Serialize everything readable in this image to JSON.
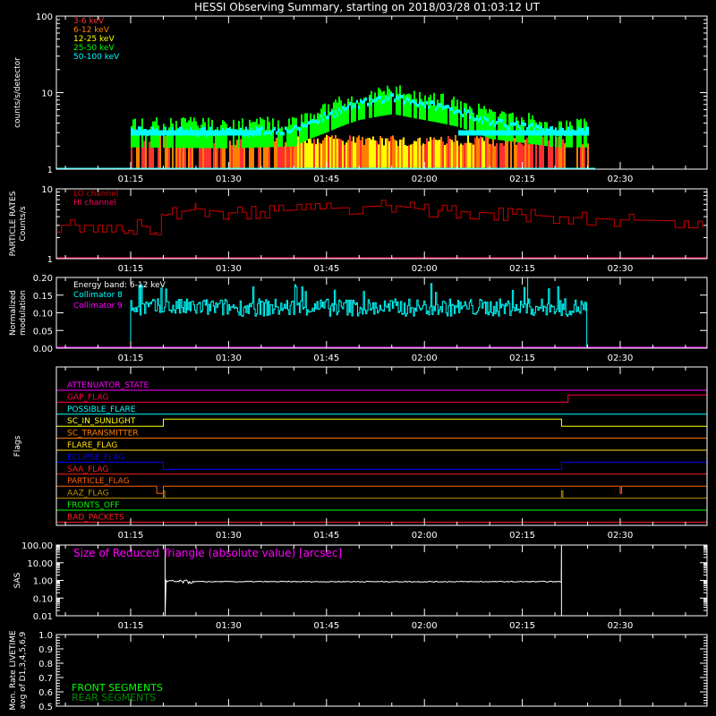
{
  "title": "HESSI Observing Summary, starting on 2018/03/28 01:03:12 UT",
  "time_ticks": [
    "01:15",
    "01:30",
    "01:45",
    "02:00",
    "02:15",
    "02:30"
  ],
  "colors": {
    "background": "#000000",
    "axes": "#ffffff"
  },
  "chart_data": [
    {
      "type": "bar",
      "panel": "count-rates",
      "ylabel": "counts/s/detector",
      "yscale": "log",
      "ylim": [
        1,
        100
      ],
      "y_ticks": [
        "1",
        "10",
        "100"
      ],
      "legend_placement": "top-left",
      "bands": [
        {
          "name": "3-6 keV",
          "color": "#ff3030"
        },
        {
          "name": "6-12 keV",
          "color": "#ff8000"
        },
        {
          "name": "12-25 keV",
          "color": "#ffff00"
        },
        {
          "name": "25-50 keV",
          "color": "#00ff00"
        },
        {
          "name": "50-100 keV",
          "color": "#00ffff"
        }
      ],
      "time_range": [
        "01:15",
        "02:25"
      ],
      "profile": [
        {
          "time": "01:15",
          "counts": 3.5
        },
        {
          "time": "01:30",
          "counts": 3.4
        },
        {
          "time": "01:40",
          "counts": 3.6
        },
        {
          "time": "01:45",
          "counts": 5.5
        },
        {
          "time": "01:50",
          "counts": 8.0
        },
        {
          "time": "01:55",
          "counts": 9.5
        },
        {
          "time": "01:58",
          "counts": 8.5
        },
        {
          "time": "02:05",
          "counts": 6.5
        },
        {
          "time": "02:10",
          "counts": 4.5
        },
        {
          "time": "02:20",
          "counts": 3.5
        },
        {
          "time": "02:25",
          "counts": 3.5
        }
      ]
    },
    {
      "type": "line",
      "panel": "particle-rates",
      "ylabel": [
        "PARTICLE RATES",
        "Counts/s"
      ],
      "yscale": "log",
      "ylim": [
        1,
        10
      ],
      "y_ticks": [
        "1",
        "10"
      ],
      "legend_placement": "top-left",
      "series": [
        {
          "name": "LO channel",
          "color": "#cc0000",
          "values": [
            [
              "01:03",
              3
            ],
            [
              "01:13",
              3
            ],
            [
              "01:14",
              2.3
            ],
            [
              "01:16",
              3
            ],
            [
              "01:18",
              2.8
            ],
            [
              "01:19",
              2.2
            ],
            [
              "01:20",
              4.2
            ],
            [
              "01:25",
              5.2
            ],
            [
              "01:30",
              4.5
            ],
            [
              "01:45",
              5.2
            ],
            [
              "01:55",
              5.8
            ],
            [
              "02:00",
              5.0
            ],
            [
              "02:10",
              4.5
            ],
            [
              "02:20",
              4.0
            ],
            [
              "02:30",
              3.6
            ],
            [
              "02:45",
              3.4
            ]
          ]
        },
        {
          "name": "HI channel",
          "color": "#ff0060",
          "values": []
        }
      ]
    },
    {
      "type": "line",
      "panel": "modulation",
      "ylabel": [
        "Normalized",
        "modulation"
      ],
      "ylim": [
        0.0,
        0.2
      ],
      "y_ticks": [
        "0.00",
        "0.05",
        "0.10",
        "0.15",
        "0.20"
      ],
      "annotation": "Energy band: 6-12 keV",
      "legend_placement": "top-left",
      "series": [
        {
          "name": "Collimator 8",
          "color": "#00ffff",
          "start": "01:15",
          "end": "02:25",
          "mean": 0.115,
          "peak": [
            "02:15",
            0.2
          ]
        },
        {
          "name": "Collimator 9",
          "color": "#ff00ff",
          "values": []
        }
      ]
    },
    {
      "type": "table",
      "panel": "flags",
      "ylabel": "Flags",
      "flags": [
        {
          "name": "ATTENUATOR_STATE",
          "color": "#ff00ff",
          "events": []
        },
        {
          "name": "GAP_FLAG",
          "color": "#ff0040",
          "events": [
            {
              "start": "02:22",
              "end": "02:45",
              "state": "high"
            }
          ]
        },
        {
          "name": "POSSIBLE_FLARE",
          "color": "#00ffff",
          "events": []
        },
        {
          "name": "SC_IN_SUNLIGHT",
          "color": "#ffff00",
          "events": [
            {
              "start": "01:20",
              "end": "02:21",
              "state": "high"
            }
          ]
        },
        {
          "name": "SC_TRANSMITTER",
          "color": "#ff8000",
          "events": []
        },
        {
          "name": "FLARE_FLAG",
          "color": "#ffe000",
          "events": []
        },
        {
          "name": "ECLIPSE_FLAG",
          "color": "#0000ff",
          "events": [
            {
              "start": "01:20",
              "end": "02:21",
              "state": "low"
            }
          ]
        },
        {
          "name": "SAA_FLAG",
          "color": "#ff2020",
          "events": []
        },
        {
          "name": "PARTICLE_FLAG",
          "color": "#ff6000",
          "events": [
            {
              "start": "01:19",
              "end": "01:20",
              "state": "low"
            },
            {
              "start": "02:30",
              "end": "02:30",
              "state": "low"
            }
          ]
        },
        {
          "name": "AAZ_FLAG",
          "color": "#c09000",
          "events": [
            {
              "start": "01:20",
              "end": "01:20",
              "state": "high"
            },
            {
              "start": "02:21",
              "end": "02:21",
              "state": "high"
            }
          ]
        },
        {
          "name": "FRONTS_OFF",
          "color": "#00ff00",
          "events": []
        },
        {
          "name": "BAD_PACKETS",
          "color": "#ff2020",
          "events": []
        }
      ]
    },
    {
      "type": "line",
      "panel": "sas",
      "ylabel": "SAS",
      "yscale": "log",
      "ylim": [
        0.01,
        100
      ],
      "y_ticks": [
        "0.01",
        "0.10",
        "1.00",
        "10.00",
        "100.00"
      ],
      "title": "Size of Reduced Triangle (absolute value) [arcsec]",
      "title_color": "#ff00ff",
      "series": [
        {
          "name": "",
          "color": "#ffffff",
          "start": "01:20",
          "end": "02:21",
          "level": 0.85,
          "spikes_to": 100
        }
      ]
    },
    {
      "type": "line",
      "panel": "livetime",
      "ylabel": [
        "Mon. Rate LIVETIME",
        "avg of D1,3,4,5,6,9"
      ],
      "ylim": [
        0.5,
        1.0
      ],
      "y_ticks": [
        "0.5",
        "0.6",
        "0.7",
        "0.8",
        "0.9",
        "1.0"
      ],
      "legend_placement": "bottom-left",
      "series": [
        {
          "name": "FRONT SEGMENTS",
          "color": "#00ff00",
          "values": []
        },
        {
          "name": "REAR SEGMENTS",
          "color": "#008800",
          "values": []
        }
      ]
    }
  ]
}
